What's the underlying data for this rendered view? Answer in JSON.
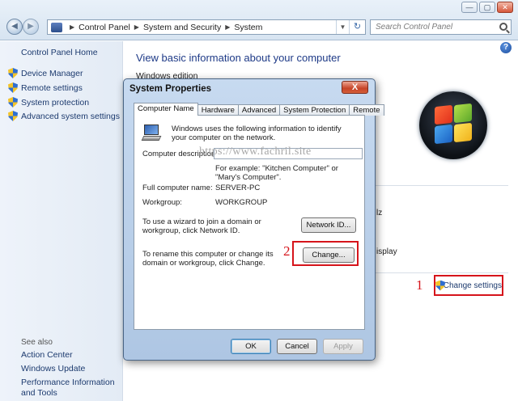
{
  "window": {
    "breadcrumbs": [
      "Control Panel",
      "System and Security",
      "System"
    ],
    "search_placeholder": "Search Control Panel",
    "min_glyph": "—",
    "max_glyph": "▢",
    "close_glyph": "✕"
  },
  "sidebar": {
    "home": "Control Panel Home",
    "items": [
      {
        "label": "Device Manager"
      },
      {
        "label": "Remote settings"
      },
      {
        "label": "System protection"
      },
      {
        "label": "Advanced system settings"
      }
    ],
    "see_also": "See also",
    "bottom_links": [
      "Action Center",
      "Windows Update",
      "Performance Information and Tools"
    ]
  },
  "main": {
    "title": "View basic information about your computer",
    "section_edition": "Windows edition",
    "partial_z": "lz",
    "partial_display": "isplay",
    "change_settings": "Change settings"
  },
  "dialog": {
    "title": "System Properties",
    "close_glyph": "X",
    "tabs": [
      "Computer Name",
      "Hardware",
      "Advanced",
      "System Protection",
      "Remote"
    ],
    "active_tab": "Computer Name",
    "intro": "Windows uses the following information to identify your computer on the network.",
    "description_label": "Computer description:",
    "description_value": "",
    "example": "For example: \"Kitchen Computer\" or \"Mary's Computer\".",
    "full_name_label": "Full computer name:",
    "full_name_value": "SERVER-PC",
    "workgroup_label": "Workgroup:",
    "workgroup_value": "WORKGROUP",
    "wizard_text": "To use a wizard to join a domain or workgroup, click Network ID.",
    "network_id_button": "Network ID...",
    "rename_text": "To rename this computer or change its domain or workgroup, click Change.",
    "change_button": "Change...",
    "ok_button": "OK",
    "cancel_button": "Cancel",
    "apply_button": "Apply"
  },
  "watermark": "https://www.fachril.site",
  "annotations": {
    "one": "1",
    "two": "2"
  },
  "colors": {
    "accent_red": "#d6141b",
    "link_blue": "#1c3a6e",
    "title_blue": "#1e3a87"
  }
}
